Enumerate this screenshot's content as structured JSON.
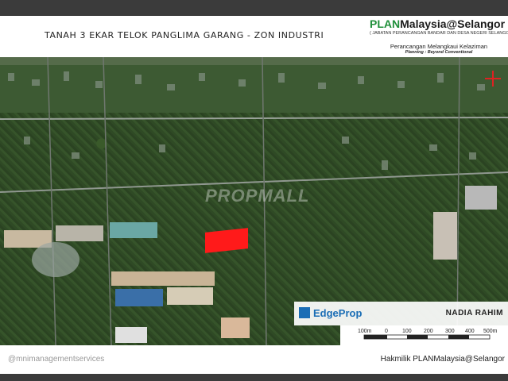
{
  "header": {
    "title": "TANAH 3 EKAR TELOK PANGLIMA GARANG - ZON INDUSTRI",
    "brand_plan": "PLAN",
    "brand_rest": "Malaysia@Selangor",
    "brand_dept": "( JABATAN PERANCANGAN BANDAR DAN DESA NEGERI SELANGOR )",
    "slogan": "Perancangan Melangkaui Kelaziman",
    "tagline": "Planning : Beyond Conventional"
  },
  "map": {
    "watermark": "PROPMALL",
    "highlight_color": "#ff1a1a"
  },
  "overlay": {
    "logo_text": "EdgeProp",
    "agent_name": "NADIA RAHIM"
  },
  "scale": {
    "labels": [
      "100m",
      "0",
      "100",
      "200",
      "300",
      "400",
      "500m"
    ]
  },
  "footer": {
    "handle": "@mnimanagementservices",
    "copyright": "Hakmilik PLANMalaysia@Selangor"
  }
}
